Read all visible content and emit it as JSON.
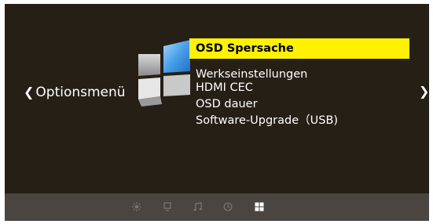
{
  "screen": {
    "left_nav": {
      "label": "Optionsmenü",
      "chevron": "❮"
    },
    "right_nav": {
      "chevron": "❯"
    }
  },
  "menu": {
    "items": [
      {
        "label": "OSD Spersache",
        "selected": true
      },
      {
        "label": "Werkseinstellungen",
        "selected": false
      },
      {
        "label": "HDMI CEC",
        "selected": false
      },
      {
        "label": "OSD dauer",
        "selected": false
      },
      {
        "label": "Software-Upgrade（USB)",
        "selected": false
      }
    ]
  },
  "bottom_tabs": [
    {
      "icon": "brightness-icon",
      "active": false
    },
    {
      "icon": "monitor-icon",
      "active": false
    },
    {
      "icon": "music-note-icon",
      "active": false
    },
    {
      "icon": "clock-icon",
      "active": false
    },
    {
      "icon": "options-grid-icon",
      "active": true
    }
  ],
  "colors": {
    "background": "#261f16",
    "highlight": "#fff200",
    "bottom_bar": "#4a4541",
    "icon_inactive": "#7c7670",
    "icon_active": "#ffffff"
  }
}
